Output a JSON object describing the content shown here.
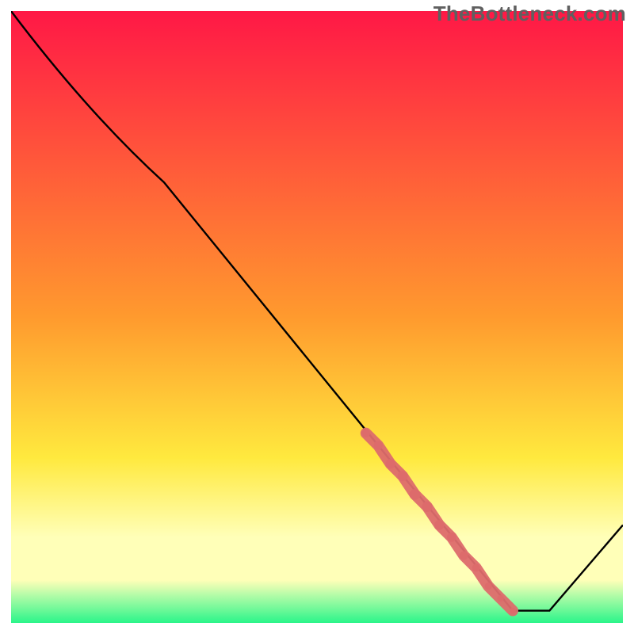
{
  "watermark": "TheBottleneck.com",
  "colors": {
    "gradient_top": "#ff1846",
    "gradient_mid1": "#ff9a2e",
    "gradient_mid2": "#ffe93e",
    "gradient_pale": "#ffffb8",
    "gradient_green": "#2bf58a",
    "line": "#000000",
    "marker": "#dd6b6b",
    "frame": "#ffffff"
  },
  "chart_data": {
    "type": "line",
    "title": "",
    "xlabel": "",
    "ylabel": "",
    "xlim": [
      0,
      100
    ],
    "ylim": [
      0,
      100
    ],
    "series": [
      {
        "name": "bottleneck-curve",
        "x": [
          0,
          25,
          82,
          88,
          100
        ],
        "values": [
          100,
          72,
          2,
          2,
          16
        ]
      }
    ],
    "markers": {
      "name": "highlighted-segment",
      "x": [
        58,
        60,
        62,
        64,
        66,
        68,
        70,
        72,
        74,
        76,
        78,
        80,
        82
      ],
      "values": [
        31,
        29,
        26,
        24,
        21,
        19,
        16,
        14,
        11,
        9,
        6,
        4,
        2
      ]
    },
    "gradient_bands_y": [
      100,
      50,
      25,
      12,
      8,
      0
    ]
  }
}
